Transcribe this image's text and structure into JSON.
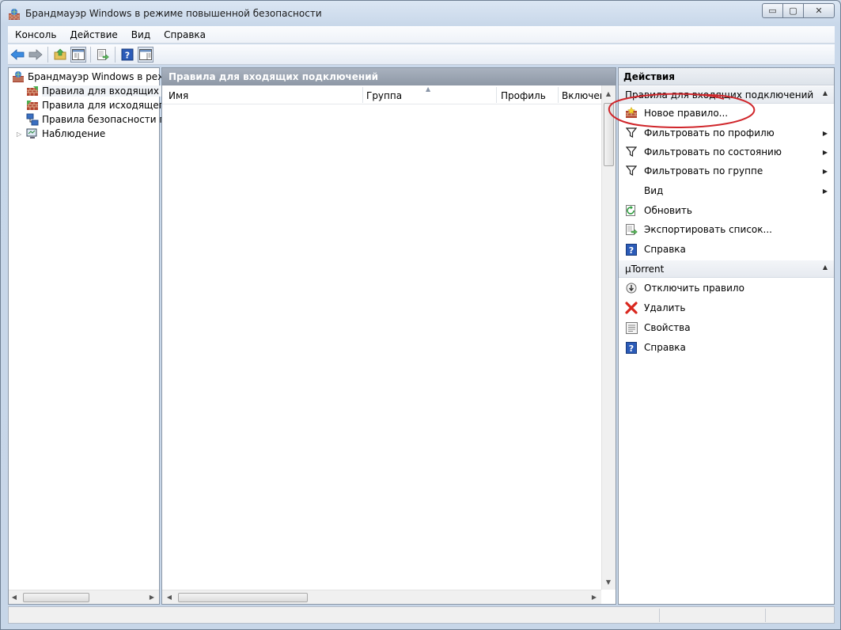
{
  "window": {
    "title": "Брандмауэр Windows в режиме повышенной безопасности",
    "caption_buttons": {
      "minimize": "▭",
      "maximize": "▢",
      "close": "✕"
    }
  },
  "menu": {
    "items": [
      "Консоль",
      "Действие",
      "Вид",
      "Справка"
    ]
  },
  "toolbar": {
    "buttons": [
      "back-arrow-icon",
      "forward-arrow-icon",
      "up-folder-icon",
      "show-hide-tree-icon",
      "export-list-icon",
      "help-icon",
      "show-hide-action-pane-icon"
    ]
  },
  "tree": {
    "root": "Брандмауэр Windows в режиме повышенной безопасности",
    "items": [
      "Правила для входящих подключений",
      "Правила для исходящего подключения",
      "Правила безопасности подключения",
      "Наблюдение"
    ],
    "selected_index": 0
  },
  "center": {
    "header": "Правила для входящих подключений",
    "columns": [
      "Имя",
      "Группа",
      "Профиль",
      "Включен"
    ]
  },
  "actions": {
    "title": "Действия",
    "sections": [
      {
        "title": "Правила для входящих подключений",
        "items": [
          {
            "label": "Новое правило...",
            "icon": "new-rule-icon"
          },
          {
            "label": "Фильтровать по профилю",
            "icon": "filter-icon",
            "submenu": true
          },
          {
            "label": "Фильтровать по состоянию",
            "icon": "filter-icon",
            "submenu": true
          },
          {
            "label": "Фильтровать по группе",
            "icon": "filter-icon",
            "submenu": true
          },
          {
            "label": "Вид",
            "icon": "",
            "submenu": true
          },
          {
            "label": "Обновить",
            "icon": "refresh-icon"
          },
          {
            "label": "Экспортировать список...",
            "icon": "export-list-icon"
          },
          {
            "label": "Справка",
            "icon": "help-icon"
          }
        ]
      },
      {
        "title": "µTorrent",
        "items": [
          {
            "label": "Отключить правило",
            "icon": "disable-rule-icon"
          },
          {
            "label": "Удалить",
            "icon": "delete-icon"
          },
          {
            "label": "Свойства",
            "icon": "properties-icon"
          },
          {
            "label": "Справка",
            "icon": "help-icon"
          }
        ]
      }
    ]
  },
  "colors": {
    "annotation_circle": "#d0262b",
    "center_header_bg": "#9aa4b2",
    "help_icon_blue": "#2b5bb8"
  }
}
